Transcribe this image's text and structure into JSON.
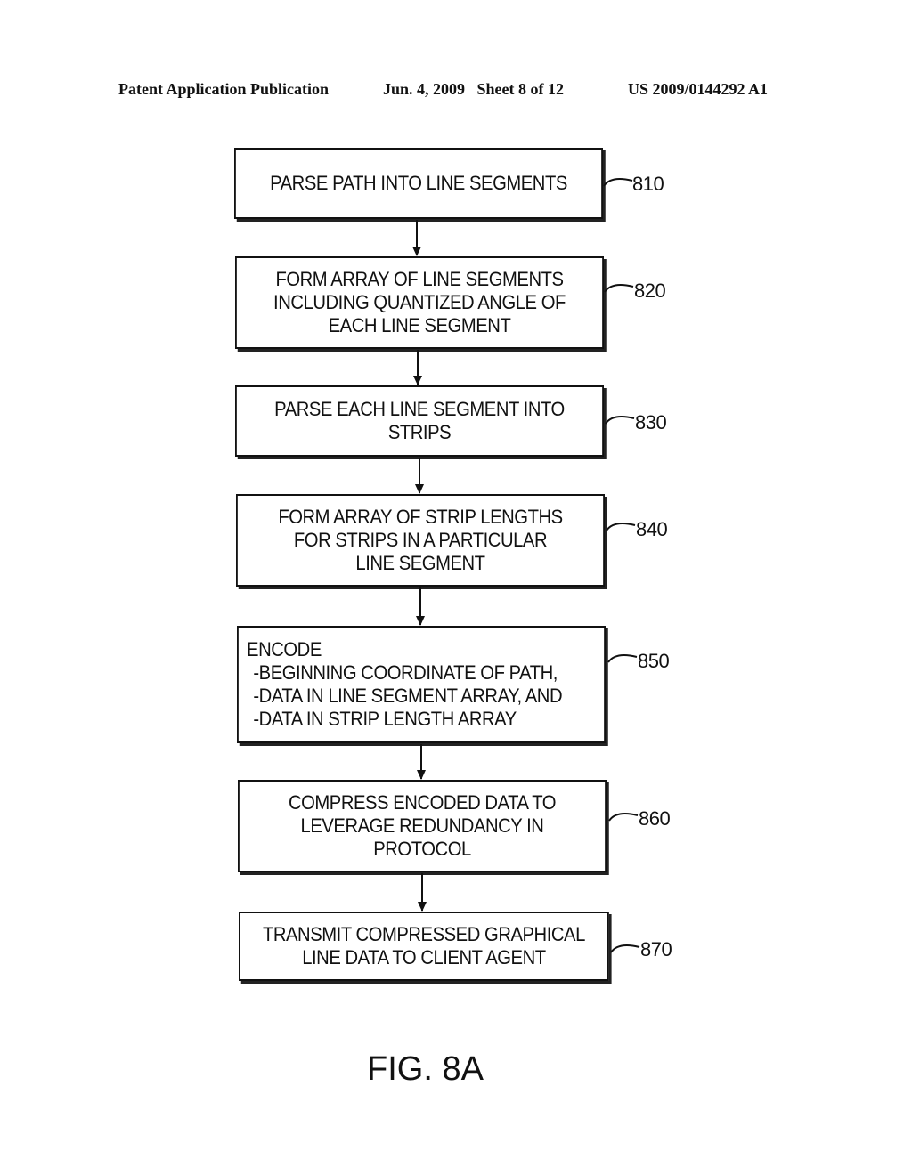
{
  "header": {
    "publication": "Patent Application Publication",
    "date_sheet": "Jun. 4, 2009   Sheet 8 of 12",
    "number": "US 2009/0144292 A1"
  },
  "steps": [
    {
      "ref": "810",
      "lines": [
        "PARSE PATH INTO LINE SEGMENTS"
      ]
    },
    {
      "ref": "820",
      "lines": [
        "FORM ARRAY OF LINE SEGMENTS",
        "INCLUDING QUANTIZED ANGLE OF",
        "EACH LINE SEGMENT"
      ]
    },
    {
      "ref": "830",
      "lines": [
        "PARSE EACH LINE SEGMENT INTO",
        "STRIPS"
      ]
    },
    {
      "ref": "840",
      "lines": [
        "FORM ARRAY OF STRIP LENGTHS",
        "FOR STRIPS IN A PARTICULAR",
        "LINE SEGMENT"
      ]
    },
    {
      "ref": "850",
      "lines": [
        "ENCODE",
        "-BEGINNING COORDINATE OF PATH,",
        "-DATA IN LINE SEGMENT ARRAY, AND",
        "-DATA IN STRIP LENGTH ARRAY"
      ]
    },
    {
      "ref": "860",
      "lines": [
        "COMPRESS ENCODED DATA TO",
        "LEVERAGE REDUNDANCY IN",
        "PROTOCOL"
      ]
    },
    {
      "ref": "870",
      "lines": [
        "TRANSMIT COMPRESSED GRAPHICAL",
        "LINE DATA TO CLIENT AGENT"
      ]
    }
  ],
  "figure_label": "FIG. 8A"
}
